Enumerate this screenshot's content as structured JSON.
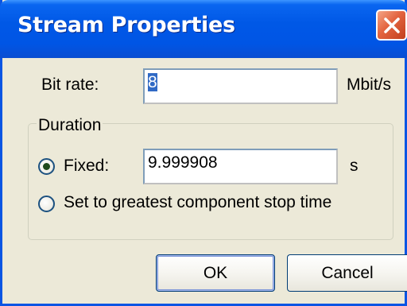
{
  "dialog": {
    "title": "Stream Properties",
    "close_icon": "close-icon",
    "accent_color": "#0055e5",
    "close_color": "#e3643f"
  },
  "bit_rate": {
    "label": "Bit rate:",
    "value": "8",
    "unit": "Mbit/s"
  },
  "duration": {
    "group_label": "Duration",
    "fixed_label": "Fixed:",
    "fixed_selected": true,
    "fixed_value": "9.999908",
    "fixed_unit": "s",
    "greatest_label": "Set to greatest component stop time",
    "greatest_selected": false
  },
  "buttons": {
    "ok_label": "OK",
    "cancel_label": "Cancel"
  }
}
